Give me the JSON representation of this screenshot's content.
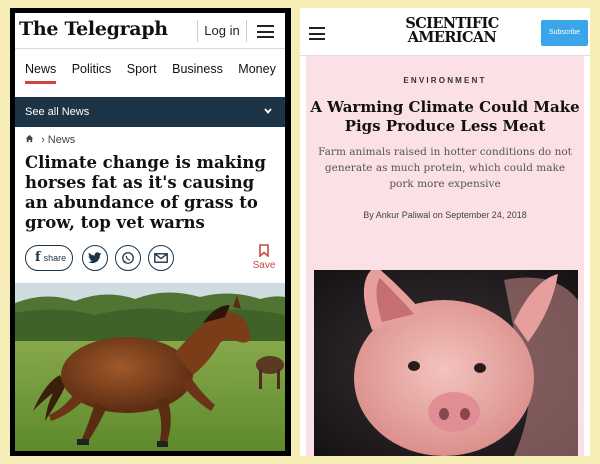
{
  "telegraph": {
    "logo": "The Telegraph",
    "login_label": "Log in",
    "nav": [
      "News",
      "Politics",
      "Sport",
      "Business",
      "Money"
    ],
    "see_all_label": "See all News",
    "breadcrumb": "News",
    "headline": "Climate change is making horses fat as it's causing an abundance of grass to grow, top vet warns",
    "share_label": "share",
    "save_label": "Save"
  },
  "sciam": {
    "logo_line1": "SCIENTIFIC",
    "logo_line2": "AMERICAN",
    "subscribe_label": "Subscribe",
    "section": "ENVIRONMENT",
    "title": "A Warming Climate Could Make Pigs Produce Less Meat",
    "dek": "Farm animals raised in hotter conditions do not generate as much protein, which could make pork more expensive",
    "byline": "By Ankur Paliwal on September 24, 2018"
  },
  "colors": {
    "background": "#f6eeb6",
    "telegraph_navy": "#1d3447",
    "telegraph_red": "#c64a46",
    "sciam_pink": "#fbe0e6",
    "sciam_subscribe_blue": "#3aa5e8"
  },
  "icons": [
    "hamburger-menu-icon",
    "chevron-down-icon",
    "home-icon",
    "facebook-icon",
    "twitter-icon",
    "whatsapp-icon",
    "email-icon",
    "bookmark-icon"
  ]
}
